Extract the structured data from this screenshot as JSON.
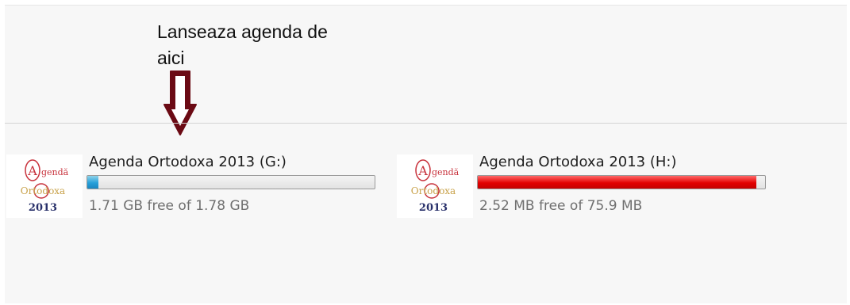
{
  "annotation": {
    "line1": "Lanseaza agenda de",
    "line2": "aici",
    "arrow_color": "#6b0a14"
  },
  "drives": [
    {
      "name": "Agenda Ortodoxa 2013 (G:)",
      "free_text": "1.71 GB free of 1.78 GB",
      "used_fraction": 0.04,
      "bar_color": "#26a0da",
      "icon": "agenda-ortodoxa-logo-icon"
    },
    {
      "name": "Agenda Ortodoxa 2013 (H:)",
      "free_text": "2.52 MB free of 75.9 MB",
      "used_fraction": 0.97,
      "bar_color": "#e30000",
      "icon": "agenda-ortodoxa-logo-icon"
    }
  ],
  "logo": {
    "letter": "A",
    "word1": "gendă",
    "word2": "Ortodoxa",
    "year": "2013"
  },
  "colors": {
    "logo_red": "#c8323c",
    "logo_gold": "#c8a24a",
    "logo_navy": "#28306a"
  }
}
